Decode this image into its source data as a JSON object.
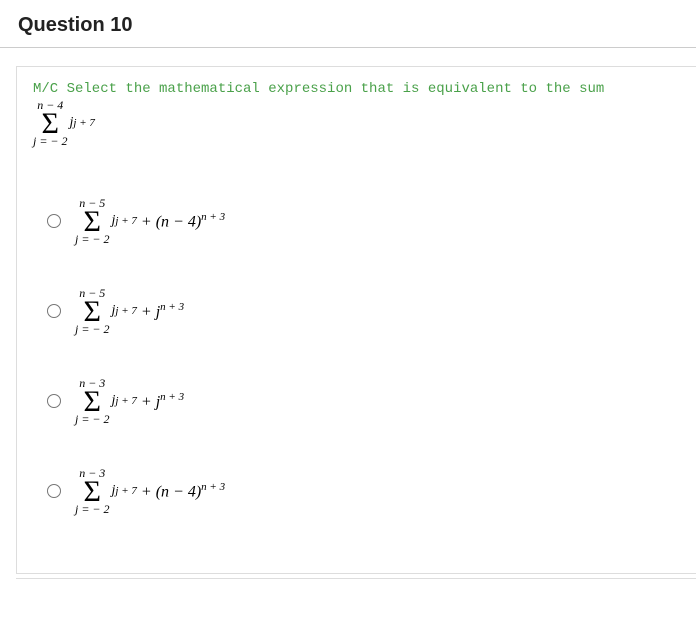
{
  "header": {
    "question_number_label": "Question 10"
  },
  "prompt": {
    "instruction": "M/C Select the mathematical expression that is equivalent to the sum",
    "sum_upper": "n − 4",
    "sum_lower": "j = − 2",
    "sum_body_base": "j",
    "sum_body_exp": "j + 7"
  },
  "options": [
    {
      "id": "opt1",
      "upper": "n − 5",
      "lower": "j = − 2",
      "body_base": "j",
      "body_exp": "j + 7",
      "tail_prefix": " + (n − 4)",
      "tail_exp": "n + 3"
    },
    {
      "id": "opt2",
      "upper": "n − 5",
      "lower": "j = − 2",
      "body_base": "j",
      "body_exp": "j + 7",
      "tail_prefix": " + j",
      "tail_exp": "n + 3"
    },
    {
      "id": "opt3",
      "upper": "n − 3",
      "lower": "j = − 2",
      "body_base": "j",
      "body_exp": "j + 7",
      "tail_prefix": " + j",
      "tail_exp": "n + 3"
    },
    {
      "id": "opt4",
      "upper": "n − 3",
      "lower": "j = − 2",
      "body_base": "j",
      "body_exp": "j + 7",
      "tail_prefix": " + (n − 4)",
      "tail_exp": "n + 3"
    }
  ]
}
